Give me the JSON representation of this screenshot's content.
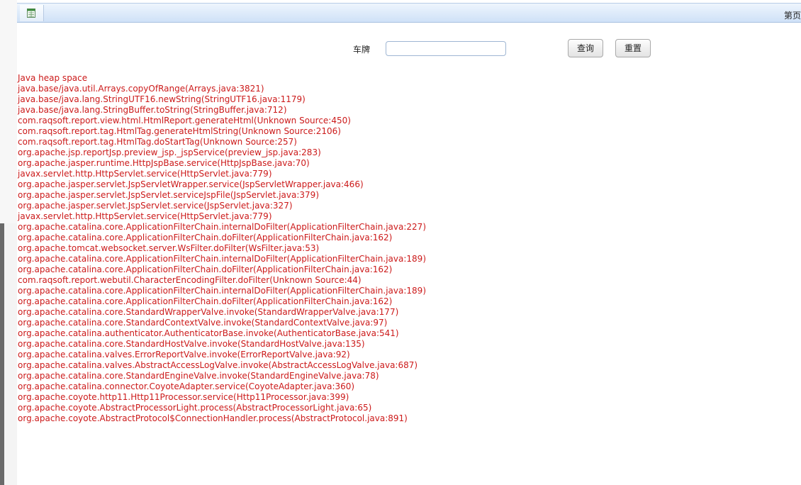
{
  "toolbar": {
    "export_icon": "excel-icon",
    "page_label": "第页"
  },
  "search": {
    "label": "车牌",
    "value": "",
    "placeholder": "",
    "query_button": "查询",
    "reset_button": "重置"
  },
  "error": {
    "lines": [
      "Java heap space",
      "java.base/java.util.Arrays.copyOfRange(Arrays.java:3821)",
      "java.base/java.lang.StringUTF16.newString(StringUTF16.java:1179)",
      "java.base/java.lang.StringBuffer.toString(StringBuffer.java:712)",
      "com.raqsoft.report.view.html.HtmlReport.generateHtml(Unknown Source:450)",
      "com.raqsoft.report.tag.HtmlTag.generateHtmlString(Unknown Source:2106)",
      "com.raqsoft.report.tag.HtmlTag.doStartTag(Unknown Source:257)",
      "org.apache.jsp.reportJsp.preview_jsp._jspService(preview_jsp.java:283)",
      "org.apache.jasper.runtime.HttpJspBase.service(HttpJspBase.java:70)",
      "javax.servlet.http.HttpServlet.service(HttpServlet.java:779)",
      "org.apache.jasper.servlet.JspServletWrapper.service(JspServletWrapper.java:466)",
      "org.apache.jasper.servlet.JspServlet.serviceJspFile(JspServlet.java:379)",
      "org.apache.jasper.servlet.JspServlet.service(JspServlet.java:327)",
      "javax.servlet.http.HttpServlet.service(HttpServlet.java:779)",
      "org.apache.catalina.core.ApplicationFilterChain.internalDoFilter(ApplicationFilterChain.java:227)",
      "org.apache.catalina.core.ApplicationFilterChain.doFilter(ApplicationFilterChain.java:162)",
      "org.apache.tomcat.websocket.server.WsFilter.doFilter(WsFilter.java:53)",
      "org.apache.catalina.core.ApplicationFilterChain.internalDoFilter(ApplicationFilterChain.java:189)",
      "org.apache.catalina.core.ApplicationFilterChain.doFilter(ApplicationFilterChain.java:162)",
      "com.raqsoft.report.webutil.CharacterEncodingFilter.doFilter(Unknown Source:44)",
      "org.apache.catalina.core.ApplicationFilterChain.internalDoFilter(ApplicationFilterChain.java:189)",
      "org.apache.catalina.core.ApplicationFilterChain.doFilter(ApplicationFilterChain.java:162)",
      "org.apache.catalina.core.StandardWrapperValve.invoke(StandardWrapperValve.java:177)",
      "org.apache.catalina.core.StandardContextValve.invoke(StandardContextValve.java:97)",
      "org.apache.catalina.authenticator.AuthenticatorBase.invoke(AuthenticatorBase.java:541)",
      "org.apache.catalina.core.StandardHostValve.invoke(StandardHostValve.java:135)",
      "org.apache.catalina.valves.ErrorReportValve.invoke(ErrorReportValve.java:92)",
      "org.apache.catalina.valves.AbstractAccessLogValve.invoke(AbstractAccessLogValve.java:687)",
      "org.apache.catalina.core.StandardEngineValve.invoke(StandardEngineValve.java:78)",
      "org.apache.catalina.connector.CoyoteAdapter.service(CoyoteAdapter.java:360)",
      "org.apache.coyote.http11.Http11Processor.service(Http11Processor.java:399)",
      "org.apache.coyote.AbstractProcessorLight.process(AbstractProcessorLight.java:65)",
      "org.apache.coyote.AbstractProtocol$ConnectionHandler.process(AbstractProtocol.java:891)"
    ]
  },
  "colors": {
    "error_text": "#cc1a1a",
    "toolbar_top": "#eef5fd",
    "toolbar_bottom": "#cfe1f7",
    "input_border": "#9fb6d3"
  }
}
